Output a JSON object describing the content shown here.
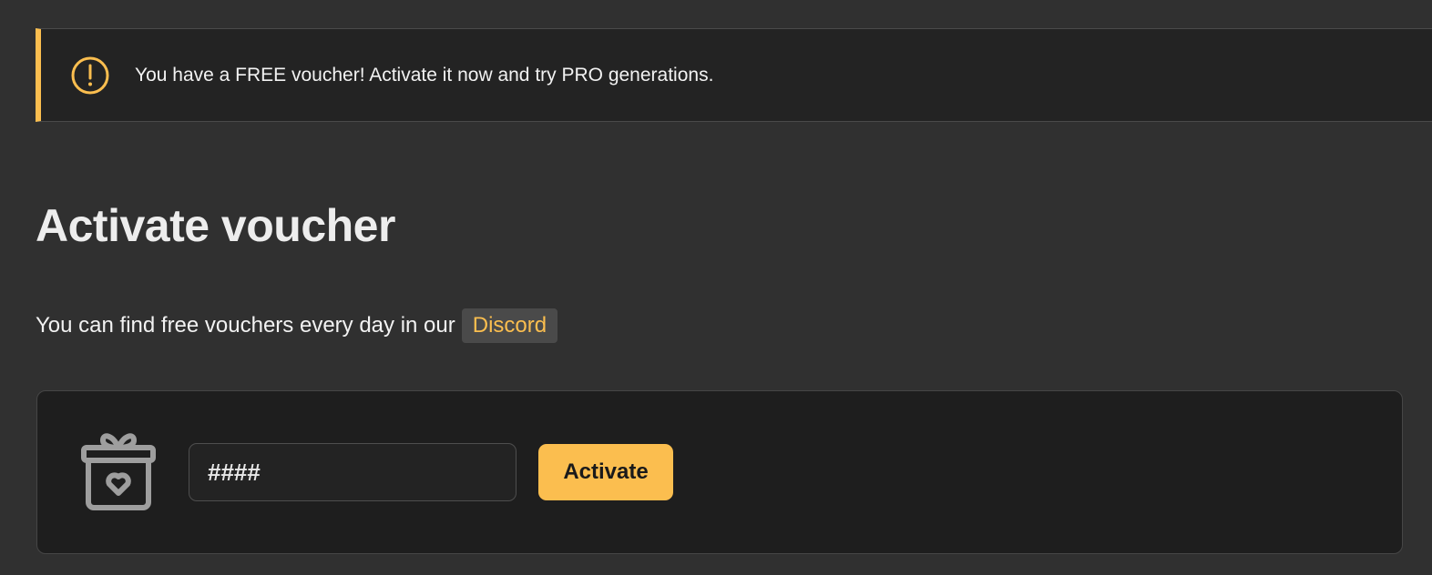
{
  "notice": {
    "icon": "exclamation-circle-icon",
    "text": "You have a FREE voucher! Activate it now and try PRO generations.",
    "accent_color": "#fbbe4f"
  },
  "page": {
    "title": "Activate voucher",
    "subtitle": "You can find free vouchers every day in our",
    "discord_link_label": "Discord"
  },
  "voucher_form": {
    "icon": "gift-heart-icon",
    "input_placeholder": "####",
    "input_value": "",
    "activate_label": "Activate",
    "button_color": "#fbbe4f"
  }
}
